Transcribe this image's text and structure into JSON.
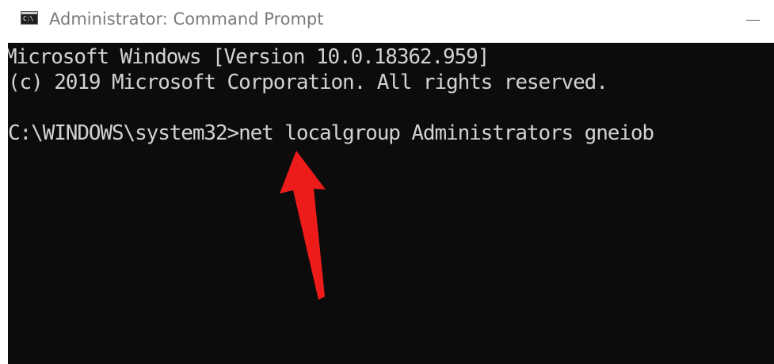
{
  "window": {
    "title": "Administrator: Command Prompt",
    "app_icon_glyph": "C:\\",
    "icon": "command-prompt-icon"
  },
  "controls": {
    "minimize_icon": "minimize-icon"
  },
  "console": {
    "lines": [
      "Microsoft Windows [Version 10.0.18362.959]",
      "(c) 2019 Microsoft Corporation. All rights reserved.",
      "C:\\WINDOWS\\system32>net localgroup Administrators gneiob"
    ],
    "text_color": "#d2d2d2",
    "background_color": "#0c0c0c"
  },
  "annotation": {
    "type": "arrow",
    "color": "#ee1b1b",
    "icon": "red-arrow-icon"
  }
}
